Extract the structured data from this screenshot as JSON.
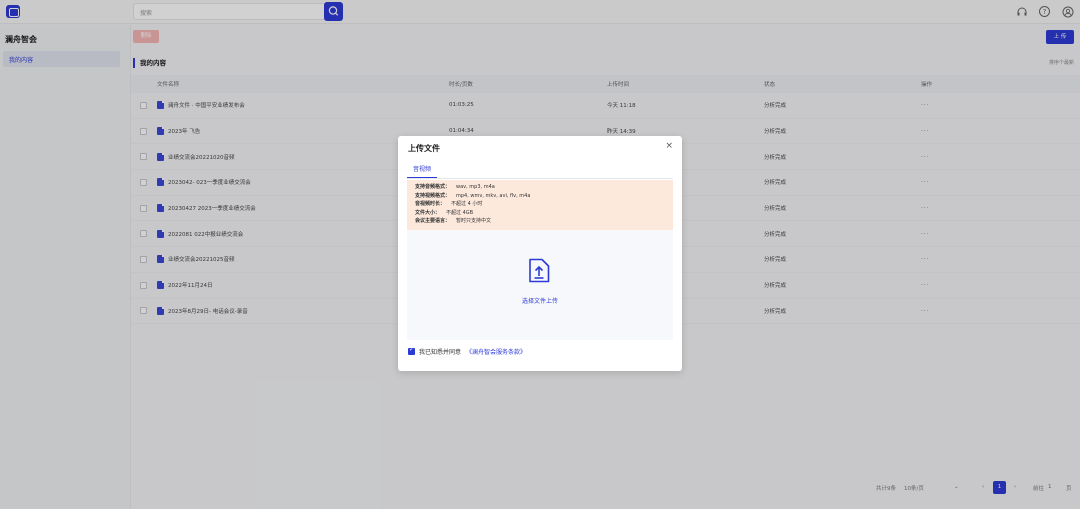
{
  "topbar": {
    "search_placeholder": "搜索",
    "icons": [
      "headset-icon",
      "help-icon",
      "user-icon"
    ]
  },
  "sidebar": {
    "title": "澜舟智会",
    "items": [
      {
        "label": "我的内容"
      }
    ]
  },
  "toolbar": {
    "delete_label": "删除",
    "upload_label": "上 传"
  },
  "section": {
    "title": "我的内容",
    "sort_hint": "排序个最新"
  },
  "table": {
    "headers": [
      "文件名称",
      "时长/页数",
      "上传时间",
      "状态",
      "操作"
    ],
    "rows": [
      {
        "name": "澜舟文件 · 中国平安业绩发布会",
        "duration": "01:03:25",
        "time": "今天 11:18",
        "status": "分析完成",
        "action": "···"
      },
      {
        "name": "2023年                    飞告",
        "duration": "01:04:34",
        "time": "昨天 14:39",
        "status": "分析完成",
        "action": "···"
      },
      {
        "name": "                    业绩交流会20221020音频",
        "duration": "",
        "time": "",
        "status": "分析完成",
        "action": "···"
      },
      {
        "name": "2023042-          023一季度业绩交流会",
        "duration": "",
        "time": "",
        "status": "分析完成",
        "action": "···"
      },
      {
        "name": "20230427          2023一季度业绩交流会",
        "duration": "",
        "time": "",
        "status": "分析完成",
        "action": "···"
      },
      {
        "name": "2022081            022中报业绩交流会",
        "duration": "",
        "time": "",
        "status": "分析完成",
        "action": "···"
      },
      {
        "name": "             业绩交流会20221025音频",
        "duration": "",
        "time": "",
        "status": "分析完成",
        "action": "···"
      },
      {
        "name": "2022年11月24日",
        "duration": "",
        "time": "",
        "status": "分析完成",
        "action": "···"
      },
      {
        "name": "2023年8月29日-                                                          电话会议-录音",
        "duration": "",
        "time": "",
        "status": "分析完成",
        "action": "···"
      }
    ]
  },
  "pagination": {
    "total": "共计9条",
    "page_size": "10条/页",
    "current_page": "1",
    "jump_label": "前往",
    "jump_value": "1",
    "page_suffix": "页"
  },
  "modal": {
    "title": "上传文件",
    "close": "×",
    "tab": "音视频",
    "info": [
      {
        "k": "支持音频格式：",
        "v": "wav, mp3, m4a"
      },
      {
        "k": "支持视频格式：",
        "v": "mp4, wmv, mkv, avi, flv, m4a"
      },
      {
        "k": "音视频时长：",
        "v": "不超过 4 小时"
      },
      {
        "k": "文件大小：",
        "v": "不超过 4GB"
      },
      {
        "k": "会议主要语言：",
        "v": "暂时只支持中文"
      }
    ],
    "drop_label": "选择文件上传",
    "agree_text": "我已知悉并同意",
    "agree_link": "《澜舟智会服务条款》"
  },
  "colors": {
    "accent": "#2d3bd6",
    "info_bg": "#fde9dc",
    "delete_bg": "#f6b5b5"
  }
}
